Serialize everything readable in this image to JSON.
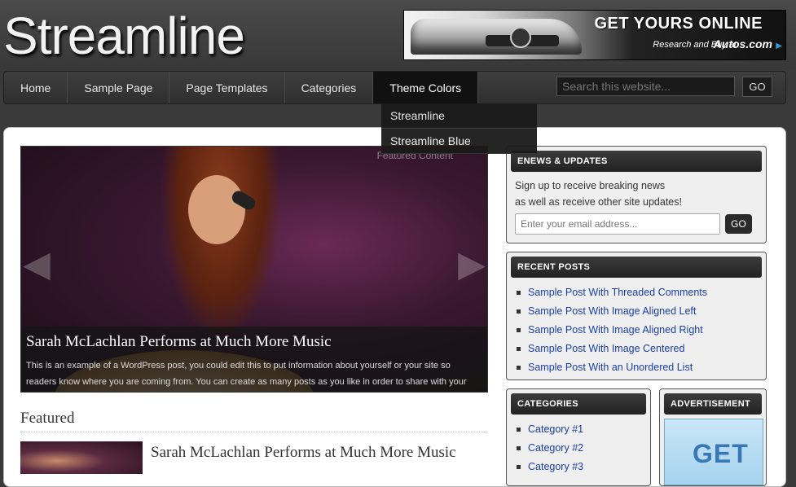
{
  "header": {
    "logo": "Streamline",
    "banner": {
      "title": "GET YOURS ONLINE",
      "subtitle": "Research and Buy at",
      "brand": "Autos.com"
    }
  },
  "nav": {
    "items": [
      {
        "label": "Home"
      },
      {
        "label": "Sample Page"
      },
      {
        "label": "Page Templates"
      },
      {
        "label": "Categories"
      },
      {
        "label": "Theme Colors"
      }
    ],
    "dropdown": [
      "Streamline",
      "Streamline Blue"
    ],
    "search": {
      "placeholder": "Search this website...",
      "button": "GO"
    }
  },
  "slider": {
    "label": "Featured Content",
    "title": "Sarah McLachlan Performs at Much More Music",
    "text": "This is an example of a WordPress post, you could edit this to put information about yourself or your site so readers know where you are coming from. You can create as many posts as you like in order to share with your readers"
  },
  "featured": {
    "heading": "Featured",
    "post_title": "Sarah McLachlan Performs at Much More Music"
  },
  "sidebar": {
    "enews": {
      "heading": "ENEWS & UPDATES",
      "line1": "Sign up to receive breaking news",
      "line2": "as well as receive other site updates!",
      "input_placeholder": "Enter your email address...",
      "button": "GO"
    },
    "recent": {
      "heading": "RECENT POSTS",
      "items": [
        "Sample Post With Threaded Comments",
        "Sample Post With Image Aligned Left",
        "Sample Post With Image Aligned Right",
        "Sample Post With Image Centered",
        "Sample Post With an Unordered List"
      ]
    },
    "categories": {
      "heading": "CATEGORIES",
      "items": [
        "Category #1",
        "Category #2",
        "Category #3"
      ]
    },
    "ad": {
      "heading": "ADVERTISEMENT",
      "text": "GET"
    }
  }
}
